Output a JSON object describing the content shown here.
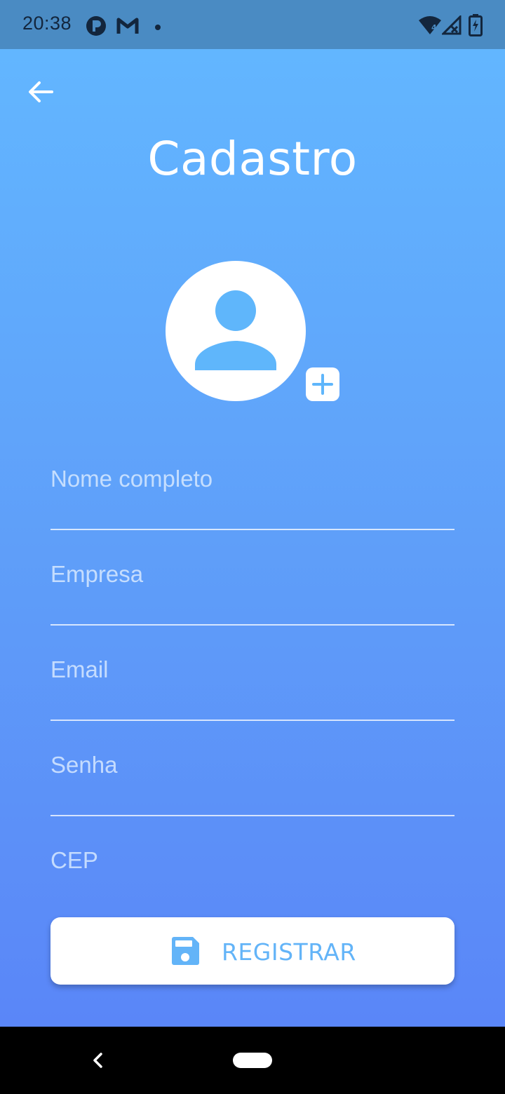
{
  "status_bar": {
    "time": "20:38",
    "icons": [
      "notification-p-icon",
      "gmail-icon",
      "dot-icon",
      "wifi-icon",
      "signal-icon",
      "battery-charging-icon"
    ]
  },
  "header": {
    "back_icon": "arrow-left-icon",
    "title": "Cadastro"
  },
  "avatar": {
    "icon": "person-icon",
    "add_icon": "plus-box-icon"
  },
  "form": {
    "fields": [
      {
        "placeholder": "Nome completo"
      },
      {
        "placeholder": "Empresa"
      },
      {
        "placeholder": "Email"
      },
      {
        "placeholder": "Senha"
      },
      {
        "placeholder": "CEP"
      }
    ],
    "register_label": "REGISTRAR",
    "register_icon": "save-icon"
  },
  "colors": {
    "status_bar": "#4a8bc3",
    "gradient_top": "#62b6ff",
    "gradient_bottom": "#5a86f8",
    "accent": "#63b4f8",
    "white": "#ffffff"
  },
  "nav_bar": {
    "back_icon": "nav-back-icon",
    "home_icon": "nav-home-pill"
  }
}
